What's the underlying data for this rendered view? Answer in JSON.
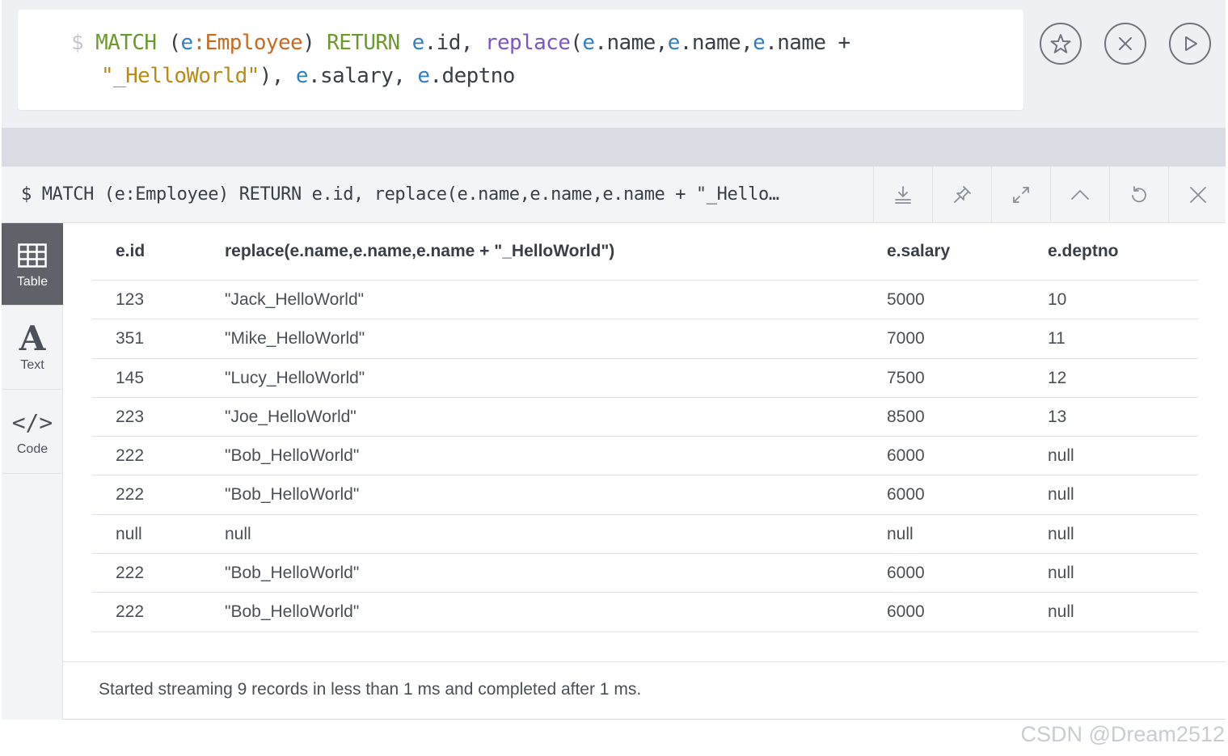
{
  "editor": {
    "prompt": "$",
    "line1": [
      {
        "t": "MATCH",
        "c": "kw"
      },
      {
        "t": " (",
        "c": "punc"
      },
      {
        "t": "e",
        "c": "ident"
      },
      {
        "t": ":Employee",
        "c": "label"
      },
      {
        "t": ") ",
        "c": "punc"
      },
      {
        "t": "RETURN",
        "c": "kw"
      },
      {
        "t": " ",
        "c": "punc"
      },
      {
        "t": "e",
        "c": "ident"
      },
      {
        "t": ".id, ",
        "c": "plain"
      },
      {
        "t": "replace",
        "c": "fn"
      },
      {
        "t": "(",
        "c": "punc"
      },
      {
        "t": "e",
        "c": "ident"
      },
      {
        "t": ".name,",
        "c": "plain"
      },
      {
        "t": "e",
        "c": "ident"
      },
      {
        "t": ".name,",
        "c": "plain"
      },
      {
        "t": "e",
        "c": "ident"
      },
      {
        "t": ".name +",
        "c": "plain"
      }
    ],
    "line2": [
      {
        "t": "\"_HelloWorld\"",
        "c": "str"
      },
      {
        "t": "), ",
        "c": "punc"
      },
      {
        "t": "e",
        "c": "ident"
      },
      {
        "t": ".salary, ",
        "c": "plain"
      },
      {
        "t": "e",
        "c": "ident"
      },
      {
        "t": ".deptno",
        "c": "plain"
      }
    ],
    "buttons": [
      {
        "name": "favorite-button",
        "icon": "star-icon"
      },
      {
        "name": "clear-button",
        "icon": "close-circle-icon"
      },
      {
        "name": "run-button",
        "icon": "play-icon"
      }
    ]
  },
  "frame": {
    "command": "$ MATCH (e:Employee) RETURN e.id, replace(e.name,e.name,e.name + \"_Hello…",
    "tools": [
      "download-icon",
      "pin-icon",
      "expand-icon",
      "collapse-icon",
      "rerun-icon",
      "close-icon"
    ],
    "nav": [
      {
        "label": "Table",
        "icon": "table-icon",
        "active": true
      },
      {
        "label": "Text",
        "icon": "text-icon",
        "active": false
      },
      {
        "label": "Code",
        "icon": "code-icon",
        "active": false
      }
    ],
    "columns": [
      "e.id",
      "replace(e.name,e.name,e.name + \"_HelloWorld\")",
      "e.salary",
      "e.deptno"
    ],
    "rows": [
      [
        "123",
        "\"Jack_HelloWorld\"",
        "5000",
        "10"
      ],
      [
        "351",
        "\"Mike_HelloWorld\"",
        "7000",
        "11"
      ],
      [
        "145",
        "\"Lucy_HelloWorld\"",
        "7500",
        "12"
      ],
      [
        "223",
        "\"Joe_HelloWorld\"",
        "8500",
        "13"
      ],
      [
        "222",
        "\"Bob_HelloWorld\"",
        "6000",
        "null"
      ],
      [
        "222",
        "\"Bob_HelloWorld\"",
        "6000",
        "null"
      ],
      [
        "null",
        "null",
        "null",
        "null"
      ],
      [
        "222",
        "\"Bob_HelloWorld\"",
        "6000",
        "null"
      ],
      [
        "222",
        "\"Bob_HelloWorld\"",
        "6000",
        "null"
      ]
    ],
    "status": "Started streaming 9 records in less than 1 ms and completed after 1 ms."
  },
  "watermark": "CSDN @Dream2512"
}
